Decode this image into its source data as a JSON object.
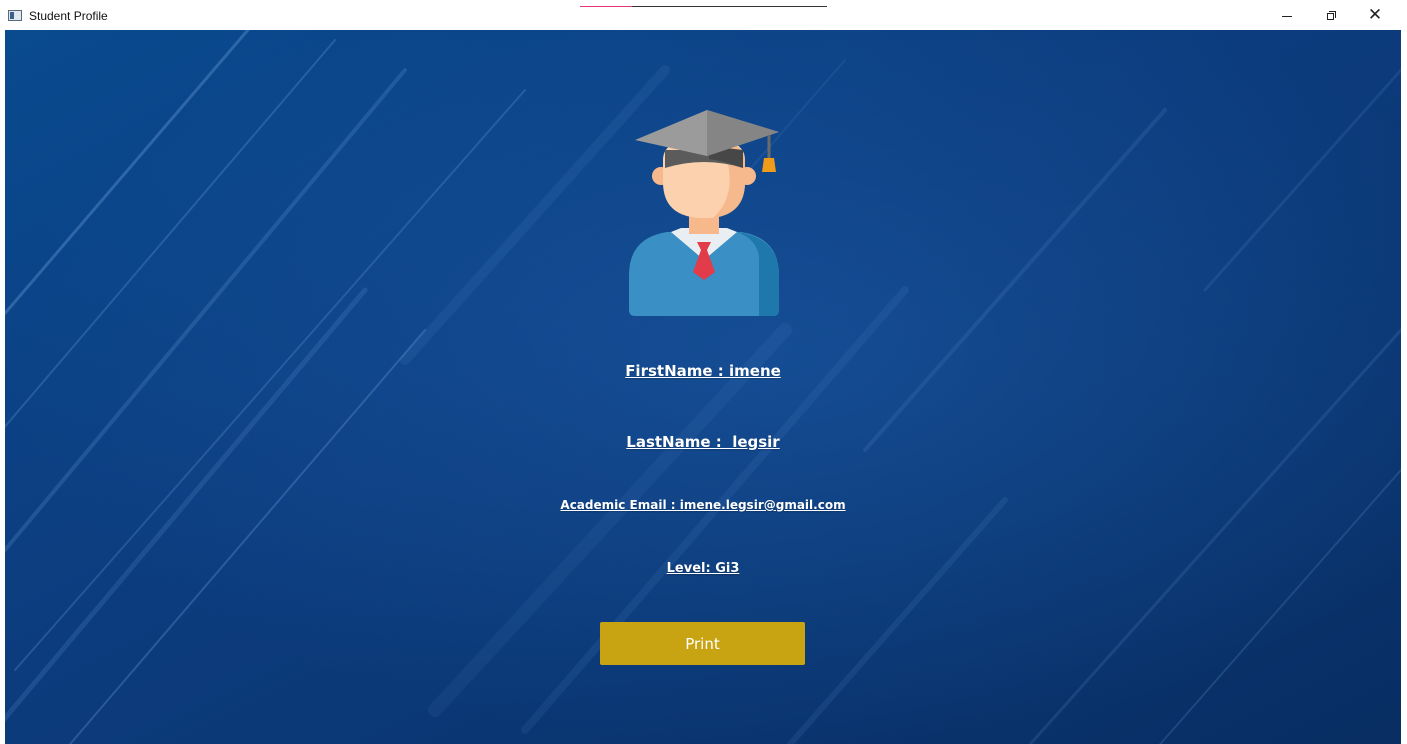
{
  "window": {
    "title": "Student Profile",
    "minimize_icon": "minimize-icon",
    "maximize_icon": "restore-icon",
    "close_icon": "close-icon"
  },
  "profile": {
    "avatar_icon": "student-graduate-icon",
    "first_name": "FirstName : imene",
    "last_name": "LastName :  legsir",
    "email": "Academic Email : imene.legsir@gmail.com",
    "level": "Level: Gi3"
  },
  "actions": {
    "print_label": "Print"
  },
  "colors": {
    "background": "#0b3a7a",
    "button": "#c8a312",
    "text": "#ffffff"
  }
}
